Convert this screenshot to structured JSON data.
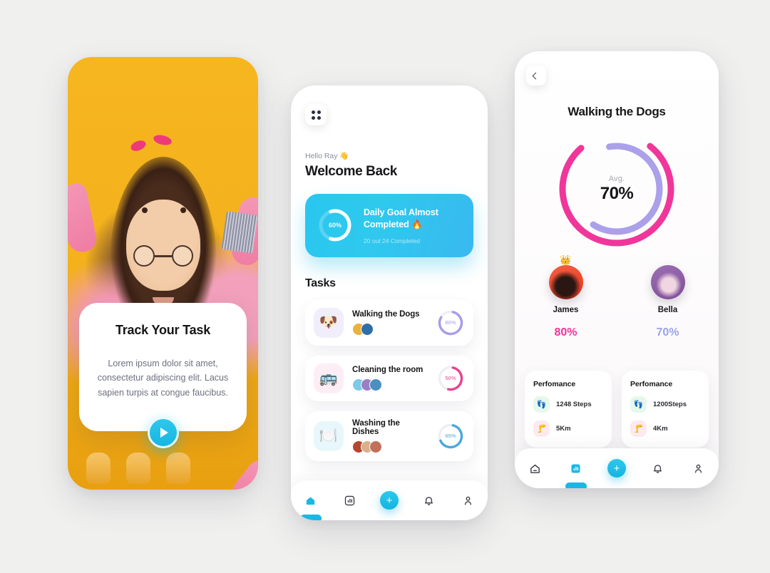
{
  "canvas": {
    "background": "#f0f0ef"
  },
  "theme": {
    "cyan": "#19b8e4",
    "pink": "#f0369b",
    "purple": "#a99ce8",
    "blue": "#4aa8dd",
    "yellow": "#f4b21d",
    "ink": "#17171a",
    "muted": "#8a8d9c"
  },
  "screen1": {
    "name": "onboarding-track-your-task",
    "photo_alt": "woman-with-glasses-and-cleaning-gloves-on-yellow-background",
    "card": {
      "title": "Track Your Task",
      "body": "Lorem ipsum dolor sit amet, consectetur adipiscing elit. Lacus sapien turpis at congue faucibus.",
      "play_button_icon": "play-icon"
    }
  },
  "screen2": {
    "name": "home-dashboard",
    "menu_icon": "grid-dots-icon",
    "greeting": "Hello Ray 👋",
    "heading": "Welcome Back",
    "goal_card": {
      "ring_percent_label": "60%",
      "ring_percent": 60,
      "title": "Daily Goal Almost Completed 🔥",
      "subtitle": "20 out 24 Completed",
      "accent": "#2fc9ee"
    },
    "tasks_heading": "Tasks",
    "tasks": [
      {
        "name": "Walking the Dogs",
        "emoji": "🐶",
        "emoji_bg": "#f0eefb",
        "percent": 80,
        "percent_label": "80%",
        "ring_color": "#a99ce8",
        "avatars": [
          "#e8b23c",
          "#2f6fa8"
        ]
      },
      {
        "name": "Cleaning the room",
        "emoji": "🚌",
        "emoji_bg": "#fdeef5",
        "percent": 50,
        "percent_label": "50%",
        "ring_color": "#e8428f",
        "avatars": [
          "#7ec8e8",
          "#9b7fc4",
          "#4a8fc0"
        ]
      },
      {
        "name": "Washing the Dishes",
        "emoji": "🍽️",
        "emoji_bg": "#e8f7fb",
        "percent": 65,
        "percent_label": "65%",
        "ring_color": "#4aa8dd",
        "avatars": [
          "#b5462f",
          "#d9b08a",
          "#c2705a"
        ]
      }
    ],
    "nav": [
      {
        "icon": "home-icon",
        "active": true
      },
      {
        "icon": "chart-bar-icon",
        "active": false
      },
      {
        "icon": "plus-icon",
        "active": false,
        "is_fab": true
      },
      {
        "icon": "bell-icon",
        "active": false
      },
      {
        "icon": "person-icon",
        "active": false
      }
    ]
  },
  "screen3": {
    "name": "task-detail-walking-the-dogs",
    "back_icon": "chevron-left-icon",
    "title": "Walking the Dogs",
    "ring": {
      "label": "Avg.",
      "value_label": "70%",
      "value": 70,
      "outer_color": "#f0369b",
      "inner_color": "#a99ce8",
      "outer_percent": 78,
      "inner_percent": 62
    },
    "people": [
      {
        "name": "James",
        "percent_label": "80%",
        "percent": 80,
        "percent_color": "#f0369b",
        "avatar_color": "#ef4a34",
        "crown_icon": "crown-icon",
        "has_crown": true
      },
      {
        "name": "Bella",
        "percent_label": "70%",
        "percent": 70,
        "percent_color": "#9aa4e8",
        "avatar_color": "#8e5fa8",
        "crown_icon": "crown-icon",
        "has_crown": false
      }
    ],
    "performance_cards": [
      {
        "title": "Perfomance",
        "rows": [
          {
            "icon": "footsteps-icon",
            "value": "1248 Steps",
            "tone": "green"
          },
          {
            "icon": "leg-distance-icon",
            "value": "5Km",
            "tone": "pink"
          }
        ]
      },
      {
        "title": "Perfomance",
        "rows": [
          {
            "icon": "footsteps-icon",
            "value": "1200Steps",
            "tone": "green"
          },
          {
            "icon": "leg-distance-icon",
            "value": "4Km",
            "tone": "pink"
          }
        ]
      }
    ],
    "nav": [
      {
        "icon": "home-icon",
        "active": false
      },
      {
        "icon": "chart-bar-icon",
        "active": true
      },
      {
        "icon": "plus-icon",
        "active": false,
        "is_fab": true
      },
      {
        "icon": "bell-icon",
        "active": false
      },
      {
        "icon": "person-icon",
        "active": false
      }
    ]
  }
}
